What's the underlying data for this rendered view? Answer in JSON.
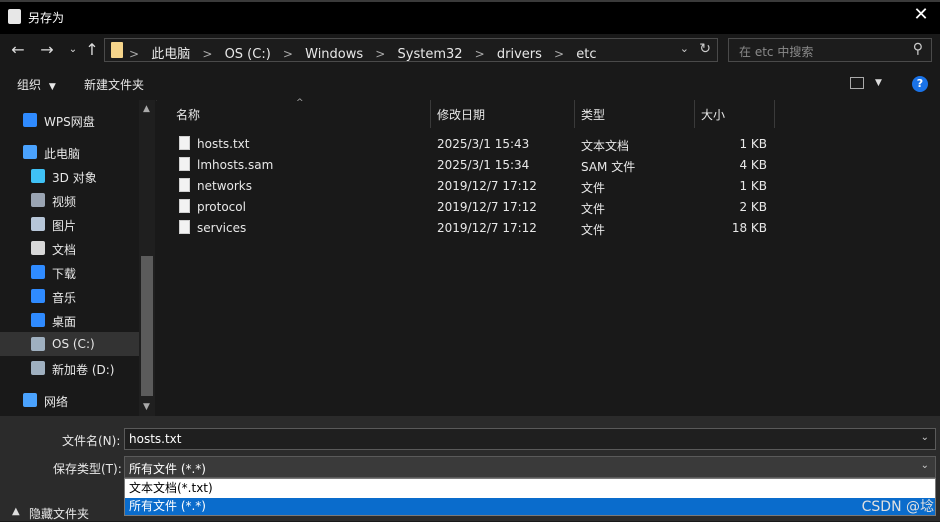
{
  "window": {
    "title": "另存为"
  },
  "breadcrumb": [
    "此电脑",
    "OS (C:)",
    "Windows",
    "System32",
    "drivers",
    "etc"
  ],
  "search": {
    "placeholder": "在 etc 中搜索"
  },
  "toolbar": {
    "organize": "组织",
    "new_folder": "新建文件夹"
  },
  "sidebar": [
    {
      "label": "WPS网盘",
      "icon": "cloud-icon",
      "color": "#2f8bff"
    },
    {
      "label": "此电脑",
      "icon": "computer-icon",
      "color": "#4aa3ff"
    },
    {
      "label": "3D 对象",
      "icon": "cube-icon",
      "color": "#3fc1f5"
    },
    {
      "label": "视频",
      "icon": "video-icon",
      "color": "#9aa4b2"
    },
    {
      "label": "图片",
      "icon": "picture-icon",
      "color": "#b7c6d8"
    },
    {
      "label": "文档",
      "icon": "document-icon",
      "color": "#d8d8d8"
    },
    {
      "label": "下载",
      "icon": "download-icon",
      "color": "#2f8bff"
    },
    {
      "label": "音乐",
      "icon": "music-icon",
      "color": "#2f8bff"
    },
    {
      "label": "桌面",
      "icon": "desktop-icon",
      "color": "#2f8bff"
    },
    {
      "label": "OS (C:)",
      "icon": "drive-icon",
      "color": "#9fb0c0"
    },
    {
      "label": "新加卷 (D:)",
      "icon": "drive-icon",
      "color": "#9fb0c0"
    },
    {
      "label": "网络",
      "icon": "network-icon",
      "color": "#4aa3ff"
    }
  ],
  "columns": [
    "名称",
    "修改日期",
    "类型",
    "大小"
  ],
  "files": [
    {
      "name": "hosts.txt",
      "date": "2025/3/1 15:43",
      "type": "文本文档",
      "size": "1 KB"
    },
    {
      "name": "lmhosts.sam",
      "date": "2025/3/1 15:34",
      "type": "SAM 文件",
      "size": "4 KB"
    },
    {
      "name": "networks",
      "date": "2019/12/7 17:12",
      "type": "文件",
      "size": "1 KB"
    },
    {
      "name": "protocol",
      "date": "2019/12/7 17:12",
      "type": "文件",
      "size": "2 KB"
    },
    {
      "name": "services",
      "date": "2019/12/7 17:12",
      "type": "文件",
      "size": "18 KB"
    }
  ],
  "form": {
    "filename_label": "文件名(N):",
    "filename_value": "hosts.txt",
    "type_label": "保存类型(T):",
    "type_value": "所有文件  (*.*)",
    "type_options": [
      "文本文档(*.txt)",
      "所有文件  (*.*)"
    ],
    "hide_folders": "隐藏文件夹"
  },
  "watermark": "CSDN @埝"
}
